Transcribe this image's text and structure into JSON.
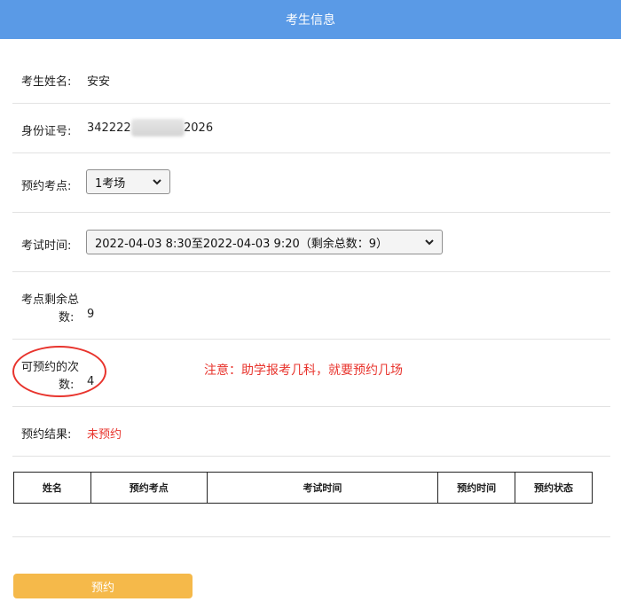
{
  "header": {
    "title": "考生信息"
  },
  "fields": {
    "name": {
      "label": "考生姓名:",
      "value": "安安"
    },
    "id_number": {
      "label": "身份证号:",
      "prefix": "342222",
      "suffix": "2026"
    },
    "exam_site": {
      "label": "预约考点:",
      "selected": "1考场"
    },
    "exam_time": {
      "label": "考试时间:",
      "selected": "2022-04-03 8:30至2022-04-03 9:20（剩余总数：9）"
    },
    "site_remaining": {
      "label_line1": "考点剩余总",
      "label_line2": "数:",
      "value": "9"
    },
    "bookable_times": {
      "label_line1": "可预约的次",
      "label_line2": "数:",
      "value": "4"
    },
    "result": {
      "label": "预约结果:",
      "value": "未预约"
    }
  },
  "note": "注意：助学报考几科，就要预约几场",
  "table": {
    "headers": [
      "姓名",
      "预约考点",
      "考试时间",
      "预约时间",
      "预约状态"
    ]
  },
  "actions": {
    "book_label": "预约"
  },
  "colors": {
    "header": "#5a9ae6",
    "accent_red": "#e8342d",
    "button": "#f5b94a"
  }
}
